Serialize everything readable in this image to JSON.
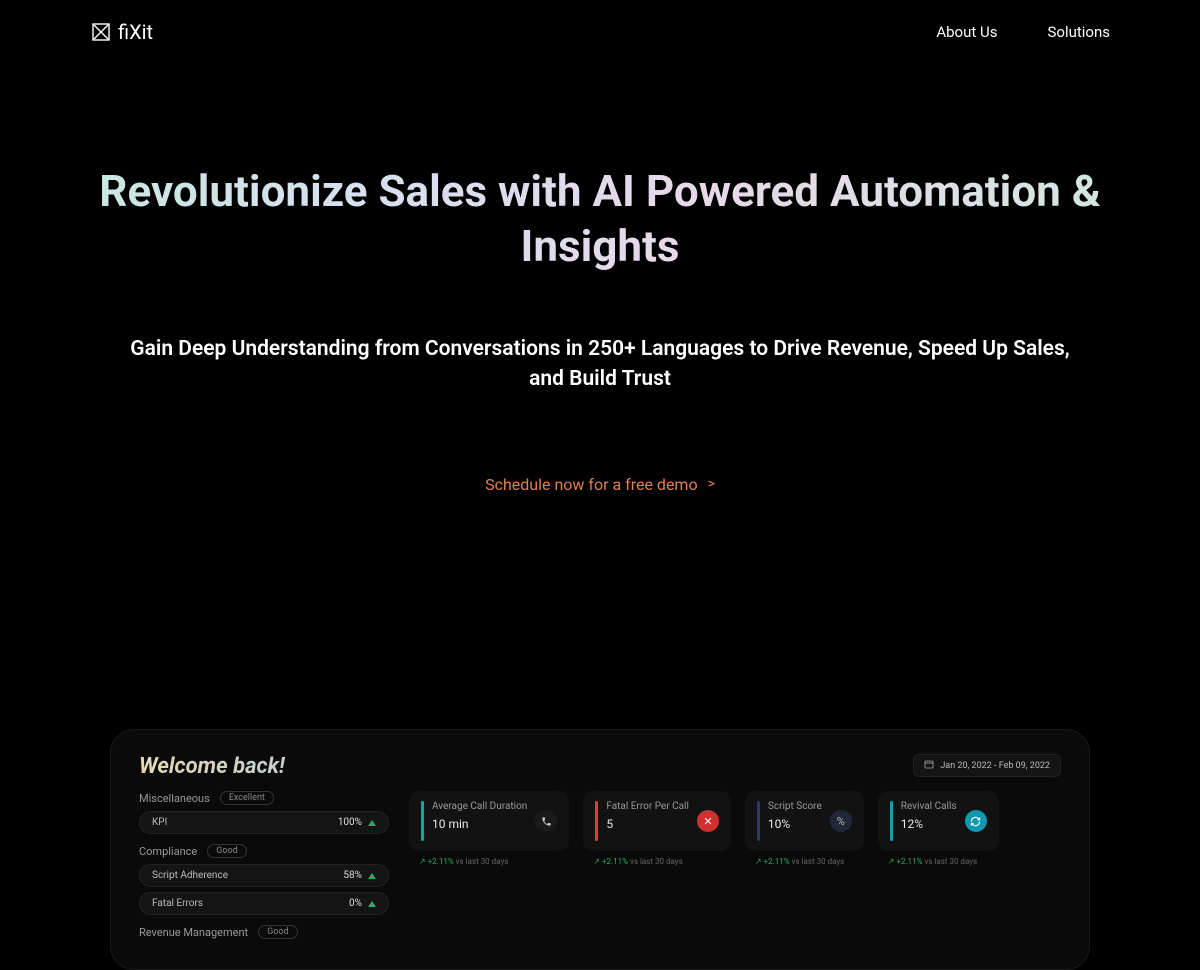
{
  "brand": {
    "name": "fiXit"
  },
  "nav": {
    "about": "About Us",
    "solutions": "Solutions"
  },
  "hero": {
    "title": "Revolutionize Sales with AI Powered Automation & Insights",
    "subtitle": "Gain Deep Understanding from Conversations in 250+ Languages to Drive Revenue, Speed Up Sales, and Build Trust",
    "cta": "Schedule now for a free demo"
  },
  "dashboard": {
    "welcome": "Welcome back!",
    "date_range": "Jan 20, 2022 - Feb 09, 2022",
    "sections": {
      "misc": {
        "label": "Miscellaneous",
        "badge": "Excellent"
      },
      "compliance": {
        "label": "Compliance",
        "badge": "Good"
      },
      "revenue": {
        "label": "Revenue Management",
        "badge": "Good"
      }
    },
    "kpis": {
      "kpi": {
        "label": "KPI",
        "value": "100%"
      },
      "adherence": {
        "label": "Script Adherence",
        "value": "58%"
      },
      "fatal": {
        "label": "Fatal Errors",
        "value": "0%"
      }
    },
    "cards": {
      "avg_duration": {
        "title": "Average Call Duration",
        "value": "10 min",
        "delta": "+2.11%",
        "delta_tail": "vs last 30 days"
      },
      "fatal_error": {
        "title": "Fatal Error Per Call",
        "value": "5",
        "delta": "+2.11%",
        "delta_tail": "vs last 30 days"
      },
      "script_score": {
        "title": "Script Score",
        "value": "10%",
        "delta": "+2.11%",
        "delta_tail": "vs last 30 days"
      },
      "revival": {
        "title": "Revival Calls",
        "value": "12%",
        "delta": "+2.11%",
        "delta_tail": "vs last 30 days"
      }
    }
  }
}
